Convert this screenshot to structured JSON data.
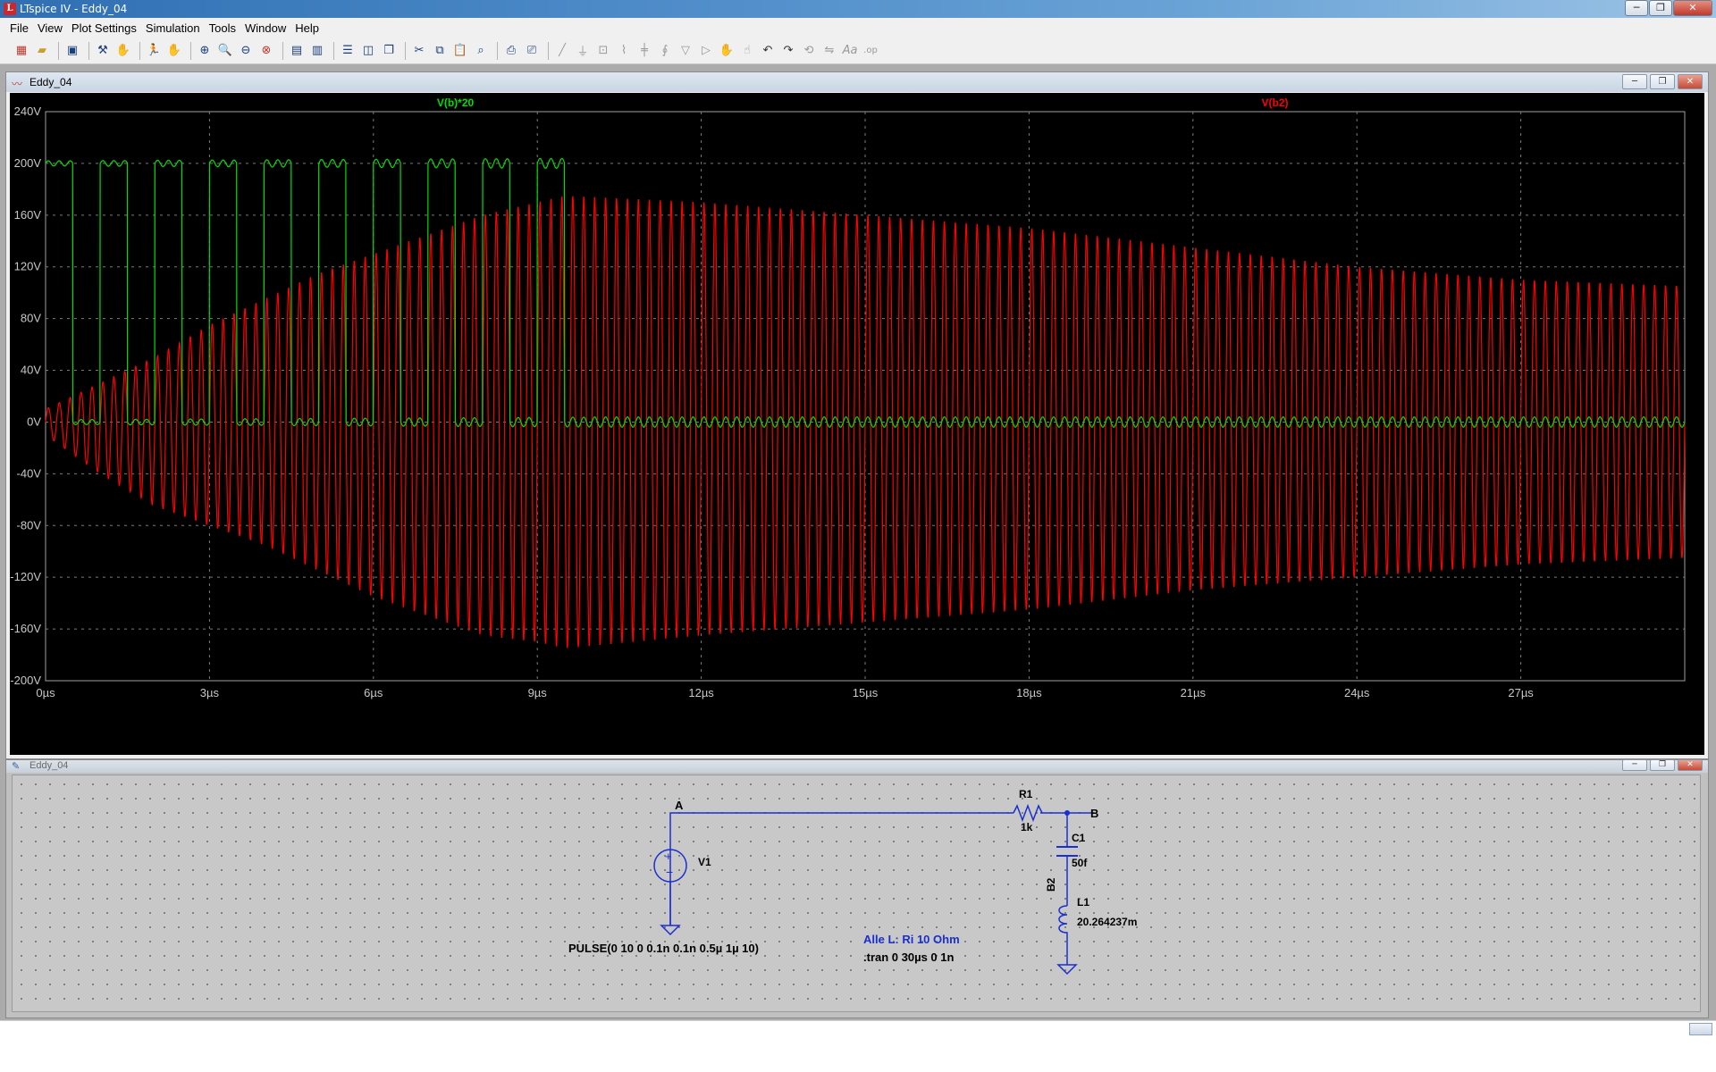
{
  "window": {
    "title": "LTspice IV - Eddy_04",
    "app_icon": "ltspice-icon",
    "min_label": "─",
    "max_label": "❐",
    "close_label": "✕"
  },
  "menu": [
    "File",
    "View",
    "Plot Settings",
    "Simulation",
    "Tools",
    "Window",
    "Help"
  ],
  "toolbar": {
    "icons": [
      "new-schematic-icon",
      "open-icon",
      "save-icon",
      "control-panel-icon",
      "run-icon",
      "halt-icon",
      "zoom-in-icon",
      "zoom-out-icon",
      "zoom-fit-icon",
      "zoom-cancel-icon",
      "autorange-icon",
      "mark-icon",
      "tile-horizontal-icon",
      "tile-vertical-icon",
      "cascade-icon",
      "cut-icon",
      "copy-icon",
      "paste-icon",
      "find-icon",
      "print-icon",
      "print-preview-icon",
      "wire-icon",
      "ground-icon",
      "label-icon",
      "resistor-icon",
      "capacitor-icon",
      "inductor-icon",
      "diode-icon",
      "component-icon",
      "move-icon",
      "drag-icon",
      "undo-icon",
      "redo-icon",
      "rotate-icon",
      "mirror-icon",
      "text-icon",
      "spice-directive-icon"
    ]
  },
  "plot_window": {
    "title": "Eddy_04",
    "traces": [
      {
        "name": "V(b)*20",
        "color": "#00e000"
      },
      {
        "name": "V(b2)",
        "color": "#ff0000"
      }
    ]
  },
  "chart_data": {
    "type": "line",
    "xlabel": "",
    "ylabel": "",
    "x_unit": "µs",
    "xlim": [
      0,
      30
    ],
    "ylim": [
      -200,
      240
    ],
    "x_ticks": [
      "0µs",
      "3µs",
      "6µs",
      "9µs",
      "12µs",
      "15µs",
      "18µs",
      "21µs",
      "24µs",
      "27µs"
    ],
    "y_ticks": [
      "240V",
      "200V",
      "160V",
      "120V",
      "80V",
      "40V",
      "0V",
      "-40V",
      "-80V",
      "-120V",
      "-160V",
      "-200V"
    ],
    "grid": true,
    "series": [
      {
        "name": "V(b)*20",
        "color": "#00e000",
        "description_points": {
          "pulse_high": 200,
          "pulse_low": 0,
          "pulse_period_us": 1,
          "pulse_width_us": 0.5,
          "pulse_count": 10,
          "ringing_amplitude_end": 4
        }
      },
      {
        "name": "V(b2)",
        "color": "#ff0000",
        "envelope_x": [
          0,
          1,
          2,
          3,
          4,
          5,
          6,
          7,
          8,
          9,
          9.5,
          12,
          15,
          18,
          21,
          24,
          27,
          30
        ],
        "envelope_pos": [
          10,
          30,
          50,
          75,
          95,
          115,
          130,
          145,
          160,
          170,
          175,
          170,
          160,
          150,
          135,
          120,
          110,
          105
        ],
        "envelope_neg": [
          -10,
          -40,
          -65,
          -80,
          -95,
          -115,
          -135,
          -150,
          -165,
          -170,
          -175,
          -165,
          -155,
          -145,
          -130,
          -120,
          -110,
          -105
        ],
        "oscillation_freq_mhz": 5
      }
    ]
  },
  "schematic_window": {
    "title": "Eddy_04",
    "labels": {
      "node_a": "A",
      "node_b": "B",
      "r1_name": "R1",
      "r1_value": "1k",
      "c1_name": "C1",
      "c1_value": "50f",
      "b2_name": "B2",
      "l1_name": "L1",
      "l1_value": "20.264237m",
      "v1_name": "V1",
      "v1_value": "PULSE(0 10 0 0.1n 0.1n 0.5µ 1µ 10)",
      "comment": "Alle L: Ri 10 Ohm",
      "directive": ".tran 0 30µs 0 1n"
    }
  }
}
